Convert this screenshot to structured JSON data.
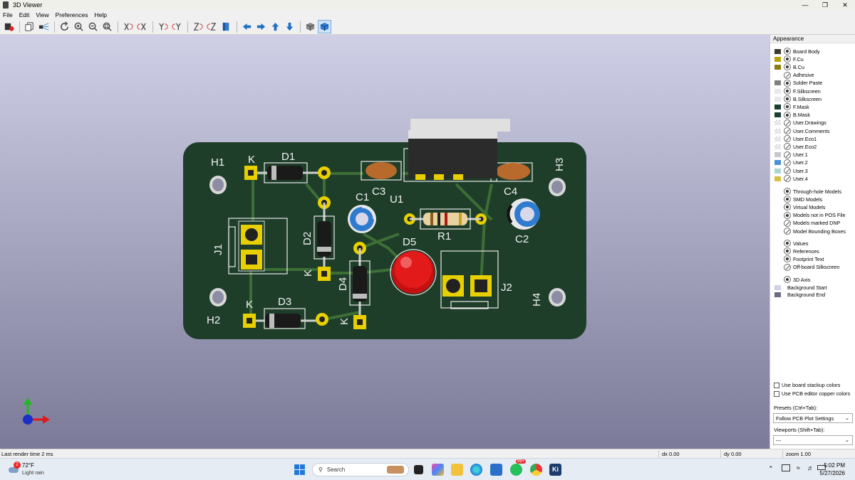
{
  "window": {
    "title": "3D Viewer"
  },
  "menu": [
    "File",
    "Edit",
    "View",
    "Preferences",
    "Help"
  ],
  "board": {
    "labels": {
      "h1": "H1",
      "h2": "H2",
      "h3": "H3",
      "h4": "H4",
      "d1": "D1",
      "d2": "D2",
      "d3": "D3",
      "d4": "D4",
      "d5": "D5",
      "c1": "C1",
      "c2": "C2",
      "c3": "C3",
      "c4": "C4",
      "j1": "J1",
      "j2": "J2",
      "u1": "U1",
      "r1": "R1",
      "k": "K"
    }
  },
  "panel": {
    "title": "Appearance",
    "layers": [
      {
        "name": "Board Body",
        "color": "#3a3a2e",
        "eye": true
      },
      {
        "name": "F.Cu",
        "color": "#b7a400",
        "eye": true
      },
      {
        "name": "B.Cu",
        "color": "#8a7d10",
        "eye": true
      },
      {
        "name": "Adhesive",
        "color": "",
        "eye": false
      },
      {
        "name": "Solder Paste",
        "color": "#808080",
        "eye": true
      },
      {
        "name": "F.Silkscreen",
        "color": "#e8e8e8",
        "eye": true
      },
      {
        "name": "B.Silkscreen",
        "color": "#e8e8e8",
        "eye": true
      },
      {
        "name": "F.Mask",
        "color": "#1c4030",
        "eye": true
      },
      {
        "name": "B.Mask",
        "color": "#1c4030",
        "eye": true
      },
      {
        "name": "User.Drawings",
        "color": "checker",
        "eye": false
      },
      {
        "name": "User.Comments",
        "color": "checker",
        "eye": false
      },
      {
        "name": "User.Eco1",
        "color": "checker",
        "eye": false
      },
      {
        "name": "User.Eco2",
        "color": "checker",
        "eye": false
      },
      {
        "name": "User.1",
        "color": "#c8c8c8",
        "eye": false
      },
      {
        "name": "User.2",
        "color": "#4a90d9",
        "eye": false
      },
      {
        "name": "User.3",
        "color": "#a8d8d0",
        "eye": false
      },
      {
        "name": "User.4",
        "color": "#d8c040",
        "eye": false
      }
    ],
    "models": [
      {
        "name": "Through-hole Models",
        "eye": true
      },
      {
        "name": "SMD Models",
        "eye": true
      },
      {
        "name": "Virtual Models",
        "eye": true
      },
      {
        "name": "Models not in POS File",
        "eye": true
      },
      {
        "name": "Models marked DNP",
        "eye": false
      },
      {
        "name": "Model Bounding Boxes",
        "eye": false
      }
    ],
    "annotations": [
      {
        "name": "Values",
        "eye": true
      },
      {
        "name": "References",
        "eye": true
      },
      {
        "name": "Footprint Text",
        "eye": true
      },
      {
        "name": "Off-board Silkscreen",
        "eye": false
      }
    ],
    "axis": {
      "name": "3D Axis",
      "eye": true
    },
    "background": [
      {
        "name": "Background Start",
        "color": "#d0d0e8"
      },
      {
        "name": "Background End",
        "color": "#6a6a88"
      }
    ],
    "use_stackup": "Use board stackup colors",
    "use_pcb_copper": "Use PCB editor copper colors",
    "presets_label": "Presets (Ctrl+Tab):",
    "presets_value": "Follow PCB Plot Settings",
    "viewports_label": "Viewports (Shift+Tab):",
    "viewports_value": "---"
  },
  "status": {
    "render": "Last render time 2 ms",
    "dx": "dx 0.00",
    "dy": "dy 0.00",
    "zoom": "zoom 1.00"
  },
  "taskbar": {
    "temp": "72°F",
    "condition": "Light rain",
    "weather_badge": "2",
    "search": "Search",
    "whatsapp_badge": "99+",
    "time": "5:02 PM",
    "date": "5/27/2026",
    "kicad_icon": "Ki"
  }
}
